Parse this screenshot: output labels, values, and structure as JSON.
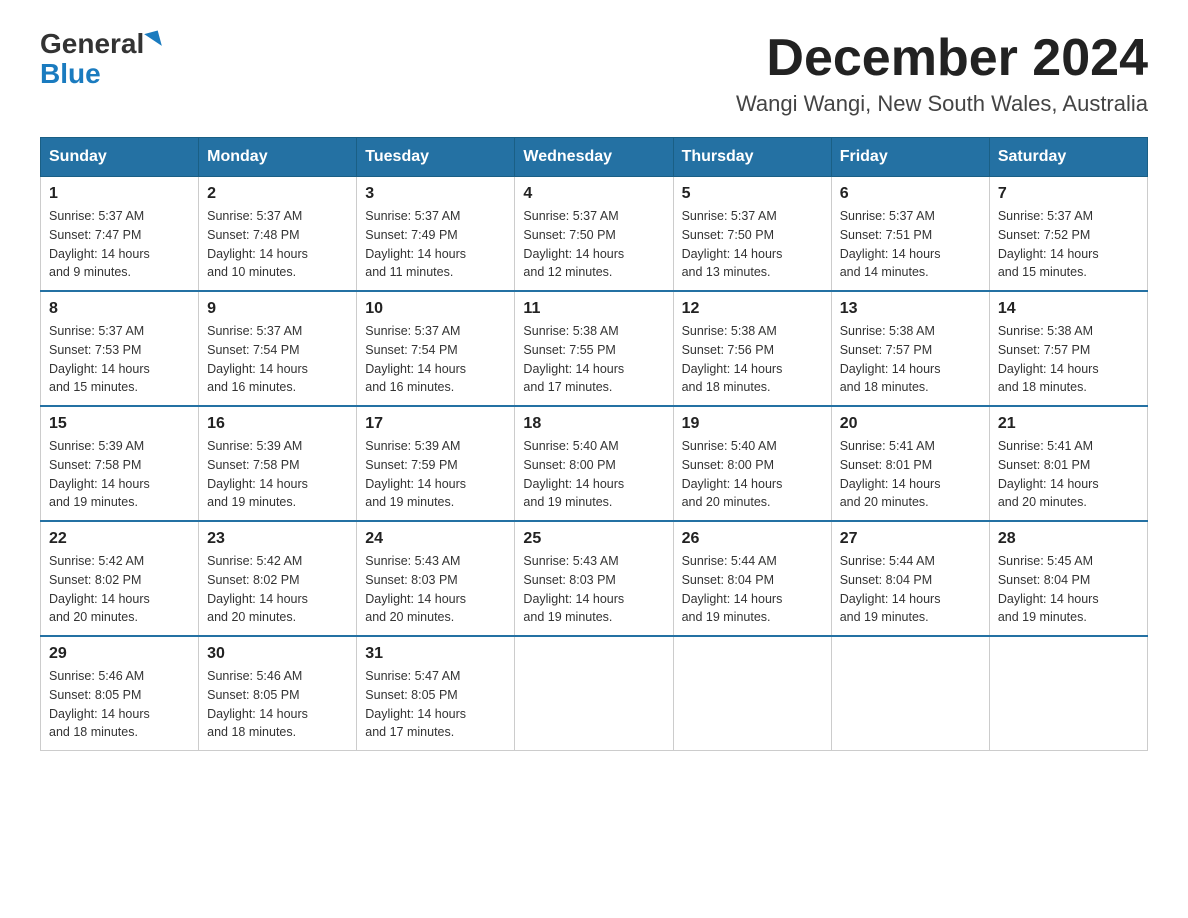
{
  "header": {
    "logo_general": "General",
    "logo_blue": "Blue",
    "month": "December 2024",
    "location": "Wangi Wangi, New South Wales, Australia"
  },
  "weekdays": [
    "Sunday",
    "Monday",
    "Tuesday",
    "Wednesday",
    "Thursday",
    "Friday",
    "Saturday"
  ],
  "weeks": [
    [
      {
        "day": "1",
        "info": "Sunrise: 5:37 AM\nSunset: 7:47 PM\nDaylight: 14 hours\nand 9 minutes."
      },
      {
        "day": "2",
        "info": "Sunrise: 5:37 AM\nSunset: 7:48 PM\nDaylight: 14 hours\nand 10 minutes."
      },
      {
        "day": "3",
        "info": "Sunrise: 5:37 AM\nSunset: 7:49 PM\nDaylight: 14 hours\nand 11 minutes."
      },
      {
        "day": "4",
        "info": "Sunrise: 5:37 AM\nSunset: 7:50 PM\nDaylight: 14 hours\nand 12 minutes."
      },
      {
        "day": "5",
        "info": "Sunrise: 5:37 AM\nSunset: 7:50 PM\nDaylight: 14 hours\nand 13 minutes."
      },
      {
        "day": "6",
        "info": "Sunrise: 5:37 AM\nSunset: 7:51 PM\nDaylight: 14 hours\nand 14 minutes."
      },
      {
        "day": "7",
        "info": "Sunrise: 5:37 AM\nSunset: 7:52 PM\nDaylight: 14 hours\nand 15 minutes."
      }
    ],
    [
      {
        "day": "8",
        "info": "Sunrise: 5:37 AM\nSunset: 7:53 PM\nDaylight: 14 hours\nand 15 minutes."
      },
      {
        "day": "9",
        "info": "Sunrise: 5:37 AM\nSunset: 7:54 PM\nDaylight: 14 hours\nand 16 minutes."
      },
      {
        "day": "10",
        "info": "Sunrise: 5:37 AM\nSunset: 7:54 PM\nDaylight: 14 hours\nand 16 minutes."
      },
      {
        "day": "11",
        "info": "Sunrise: 5:38 AM\nSunset: 7:55 PM\nDaylight: 14 hours\nand 17 minutes."
      },
      {
        "day": "12",
        "info": "Sunrise: 5:38 AM\nSunset: 7:56 PM\nDaylight: 14 hours\nand 18 minutes."
      },
      {
        "day": "13",
        "info": "Sunrise: 5:38 AM\nSunset: 7:57 PM\nDaylight: 14 hours\nand 18 minutes."
      },
      {
        "day": "14",
        "info": "Sunrise: 5:38 AM\nSunset: 7:57 PM\nDaylight: 14 hours\nand 18 minutes."
      }
    ],
    [
      {
        "day": "15",
        "info": "Sunrise: 5:39 AM\nSunset: 7:58 PM\nDaylight: 14 hours\nand 19 minutes."
      },
      {
        "day": "16",
        "info": "Sunrise: 5:39 AM\nSunset: 7:58 PM\nDaylight: 14 hours\nand 19 minutes."
      },
      {
        "day": "17",
        "info": "Sunrise: 5:39 AM\nSunset: 7:59 PM\nDaylight: 14 hours\nand 19 minutes."
      },
      {
        "day": "18",
        "info": "Sunrise: 5:40 AM\nSunset: 8:00 PM\nDaylight: 14 hours\nand 19 minutes."
      },
      {
        "day": "19",
        "info": "Sunrise: 5:40 AM\nSunset: 8:00 PM\nDaylight: 14 hours\nand 20 minutes."
      },
      {
        "day": "20",
        "info": "Sunrise: 5:41 AM\nSunset: 8:01 PM\nDaylight: 14 hours\nand 20 minutes."
      },
      {
        "day": "21",
        "info": "Sunrise: 5:41 AM\nSunset: 8:01 PM\nDaylight: 14 hours\nand 20 minutes."
      }
    ],
    [
      {
        "day": "22",
        "info": "Sunrise: 5:42 AM\nSunset: 8:02 PM\nDaylight: 14 hours\nand 20 minutes."
      },
      {
        "day": "23",
        "info": "Sunrise: 5:42 AM\nSunset: 8:02 PM\nDaylight: 14 hours\nand 20 minutes."
      },
      {
        "day": "24",
        "info": "Sunrise: 5:43 AM\nSunset: 8:03 PM\nDaylight: 14 hours\nand 20 minutes."
      },
      {
        "day": "25",
        "info": "Sunrise: 5:43 AM\nSunset: 8:03 PM\nDaylight: 14 hours\nand 19 minutes."
      },
      {
        "day": "26",
        "info": "Sunrise: 5:44 AM\nSunset: 8:04 PM\nDaylight: 14 hours\nand 19 minutes."
      },
      {
        "day": "27",
        "info": "Sunrise: 5:44 AM\nSunset: 8:04 PM\nDaylight: 14 hours\nand 19 minutes."
      },
      {
        "day": "28",
        "info": "Sunrise: 5:45 AM\nSunset: 8:04 PM\nDaylight: 14 hours\nand 19 minutes."
      }
    ],
    [
      {
        "day": "29",
        "info": "Sunrise: 5:46 AM\nSunset: 8:05 PM\nDaylight: 14 hours\nand 18 minutes."
      },
      {
        "day": "30",
        "info": "Sunrise: 5:46 AM\nSunset: 8:05 PM\nDaylight: 14 hours\nand 18 minutes."
      },
      {
        "day": "31",
        "info": "Sunrise: 5:47 AM\nSunset: 8:05 PM\nDaylight: 14 hours\nand 17 minutes."
      },
      {
        "day": "",
        "info": ""
      },
      {
        "day": "",
        "info": ""
      },
      {
        "day": "",
        "info": ""
      },
      {
        "day": "",
        "info": ""
      }
    ]
  ]
}
